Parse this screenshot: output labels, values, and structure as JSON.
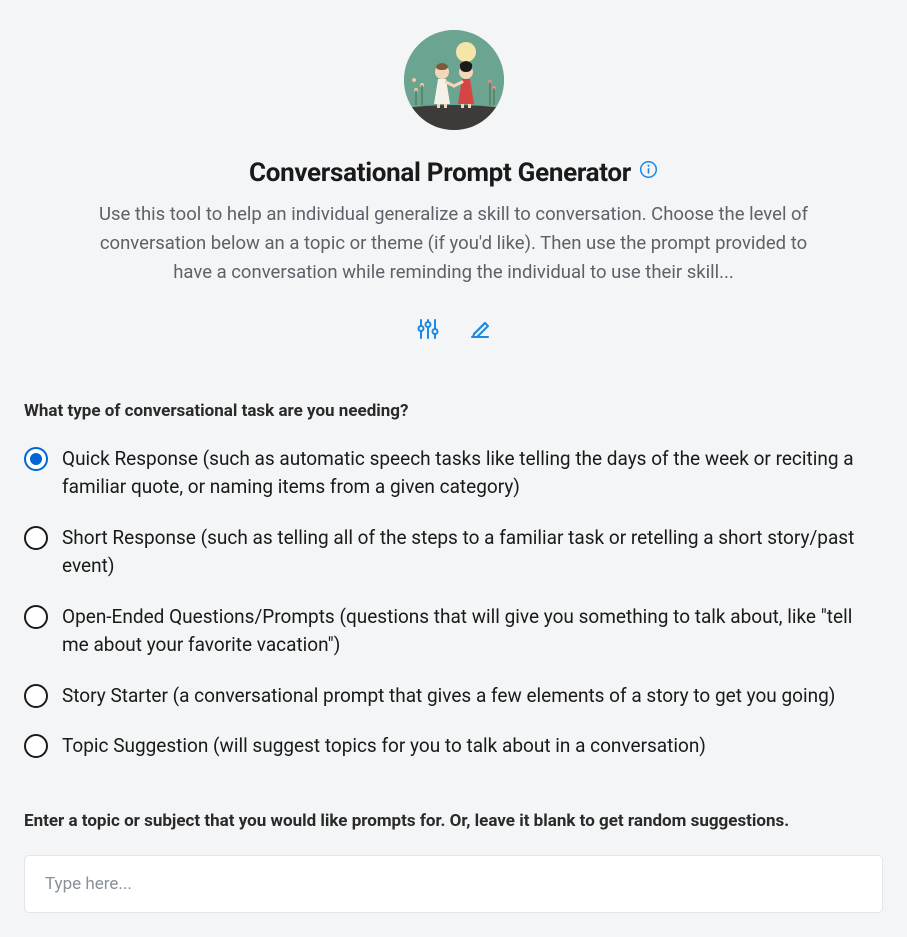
{
  "header": {
    "title": "Conversational Prompt Generator",
    "description": "Use this tool to help an individual generalize a skill to conversation. Choose the level of conversation below an a topic or theme (if you'd like). Then use the prompt provided to have a conversation while reminding the individual to use their skill..."
  },
  "form": {
    "question1_label": "What type of conversational task are you needing?",
    "radio_options": [
      {
        "label": "Quick Response (such as automatic speech tasks like telling the days of the week or reciting a familiar quote, or naming items from a given category)",
        "selected": true
      },
      {
        "label": "Short Response (such as telling all of the steps to a familiar task or retelling a short story/past event)",
        "selected": false
      },
      {
        "label": "Open-Ended Questions/Prompts (questions that will give you something to talk about, like \"tell me about your favorite vacation\")",
        "selected": false
      },
      {
        "label": "Story Starter (a conversational prompt that gives a few elements of a story to get you going)",
        "selected": false
      },
      {
        "label": "Topic Suggestion (will suggest topics for you to talk about in a conversation)",
        "selected": false
      }
    ],
    "question2_label": "Enter a topic or subject that you would like prompts for. Or, leave it blank to get random suggestions.",
    "topic_placeholder": "Type here...",
    "topic_value": ""
  }
}
